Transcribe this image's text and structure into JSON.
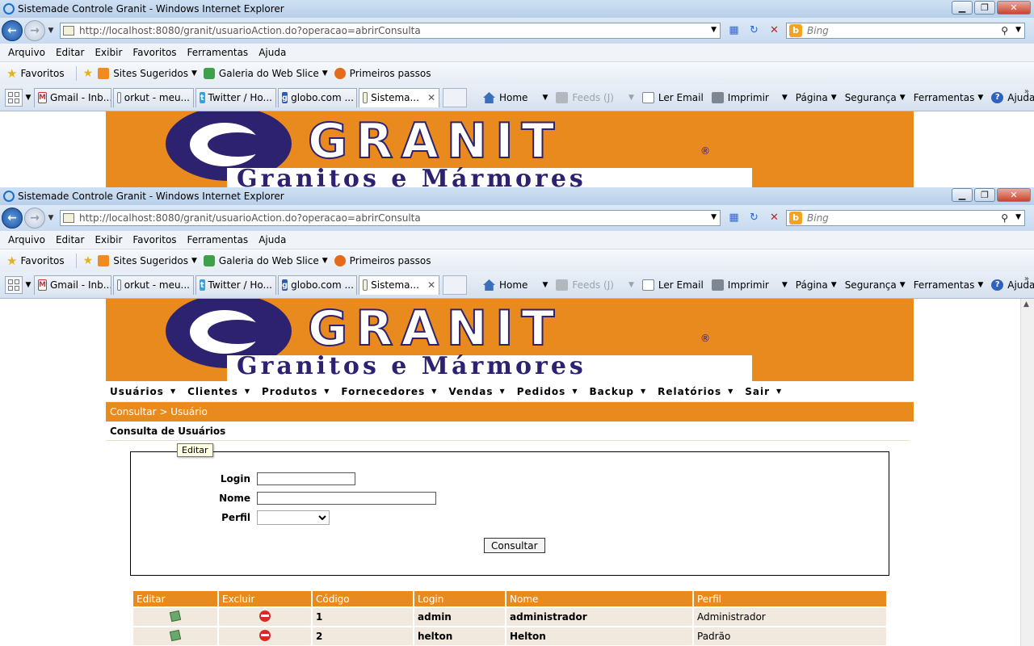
{
  "window": {
    "title": "Sistemade Controle Granit - Windows Internet Explorer",
    "controls": {
      "minimize": "▁",
      "maximize": "❐",
      "close": "✕"
    }
  },
  "address": {
    "url": "http://localhost:8080/granit/usuarioAction.do?operacao=abrirConsulta",
    "search_placeholder": "Bing",
    "search_engine_icon": "bing-icon"
  },
  "menubar": [
    "Arquivo",
    "Editar",
    "Exibir",
    "Favoritos",
    "Ferramentas",
    "Ajuda"
  ],
  "favorites": {
    "label": "Favoritos",
    "items": [
      "Sites Sugeridos",
      "Galeria do Web Slice",
      "Primeiros passos"
    ]
  },
  "tabs": [
    {
      "label": "Gmail - Inb...",
      "icon": "gmail-icon",
      "icon_text": "M"
    },
    {
      "label": "orkut - meu...",
      "icon": "orkut-icon",
      "icon_text": ""
    },
    {
      "label": "Twitter / Ho...",
      "icon": "twitter-icon",
      "icon_text": "t"
    },
    {
      "label": "globo.com ...",
      "icon": "globo-icon",
      "icon_text": "g"
    },
    {
      "label": "Sistema...",
      "icon": "page-icon",
      "icon_text": "",
      "active": true
    }
  ],
  "commandbar": {
    "home": "Home",
    "feeds": "Feeds (J)",
    "email": "Ler Email",
    "print": "Imprimir",
    "page": "Página",
    "safety": "Segurança",
    "tools": "Ferramentas",
    "help": "Ajuda"
  },
  "banner": {
    "brand": "GRANIT",
    "tagline": "Granitos e Mármores",
    "reg_mark": "®",
    "colors": {
      "orange": "#e98a1f",
      "navy": "#2c2270"
    }
  },
  "app_menu": [
    "Usuários",
    "Clientes",
    "Produtos",
    "Fornecedores",
    "Vendas",
    "Pedidos",
    "Backup",
    "Relatórios",
    "Sair"
  ],
  "breadcrumb": "Consultar > Usuário",
  "page_title": "Consulta de Usuários",
  "form": {
    "login_label": "Login",
    "nome_label": "Nome",
    "perfil_label": "Perfil",
    "login_value": "",
    "nome_value": "",
    "perfil_value": "",
    "submit_label": "Consultar"
  },
  "table": {
    "columns": [
      "Editar",
      "Excluir",
      "Código",
      "Login",
      "Nome",
      "Perfil"
    ],
    "rows": [
      {
        "codigo": "1",
        "login": "admin",
        "nome": "administrador",
        "perfil": "Administrador"
      },
      {
        "codigo": "2",
        "login": "helton",
        "nome": "Helton",
        "perfil": "Padrão"
      }
    ]
  },
  "tooltip": "Editar"
}
